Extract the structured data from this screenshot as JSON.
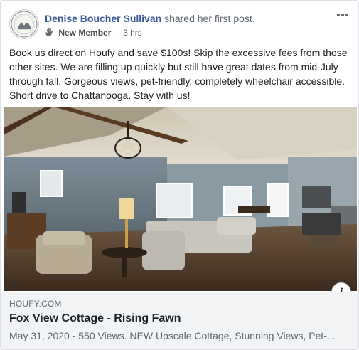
{
  "post": {
    "author": "Denise Boucher Sullivan",
    "action": "shared her first post.",
    "badge_icon": "wave-hand-icon",
    "badge": "New Member",
    "separator": "·",
    "time": "3 hrs",
    "more_icon": "more-horizontal-icon",
    "text": "Book us direct on Houfy and save $100s! Skip the excessive fees from those other sites. We are filling up quickly but still have great dates from mid-July through fall. Gorgeous views, pet-friendly, completely wheelchair accessible. Short drive to Chattanooga. Stay with us!"
  },
  "photo": {
    "subject": "living-room-photo"
  },
  "info_button": {
    "label": "i",
    "icon": "info-icon"
  },
  "link": {
    "domain": "HOUFY.COM",
    "title": "Fox View Cottage - Rising Fawn",
    "description": "May 31, 2020 - 550 Views. NEW Upscale Cottage, Stunning Views, Pet-..."
  },
  "colors": {
    "name_link": "#385898",
    "meta": "#606770",
    "card_bg": "#f2f3f5",
    "border": "#dddfe2"
  }
}
